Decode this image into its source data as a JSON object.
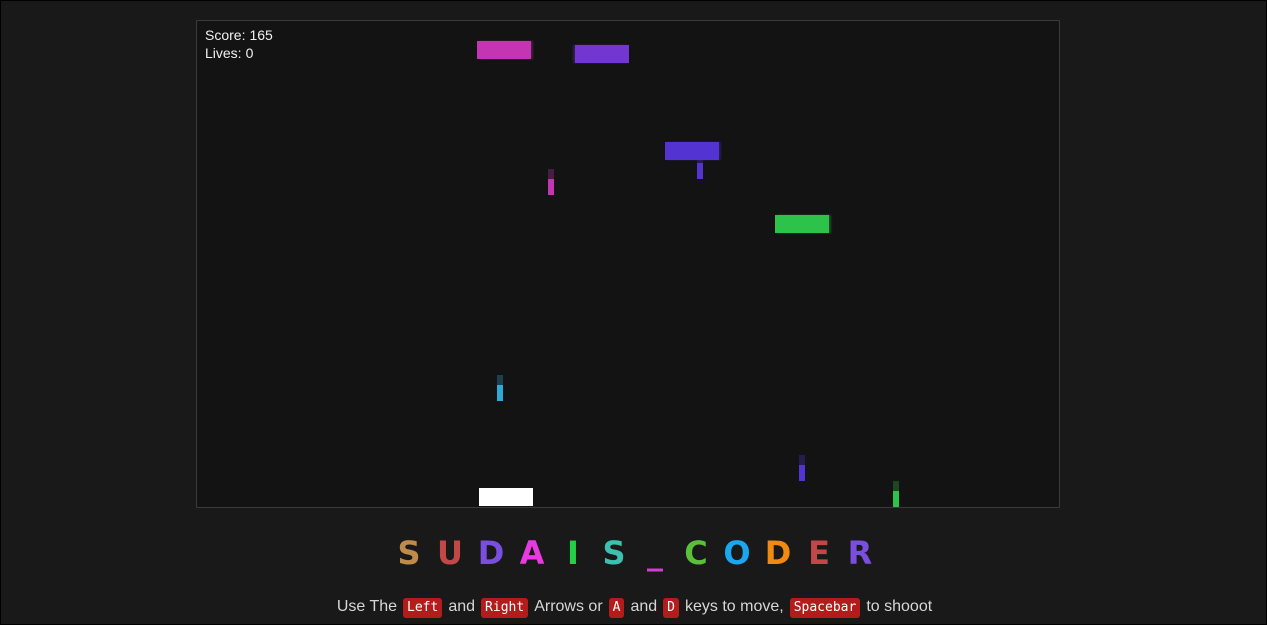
{
  "game": {
    "hud": {
      "score_label": "Score:",
      "score_value": "165",
      "lives_label": "Lives:",
      "lives_value": "0"
    },
    "enemies": [
      {
        "color": "#c435b4"
      },
      {
        "color": "#7436d0"
      },
      {
        "color": "#5334d2"
      },
      {
        "color": "#2dc34a"
      }
    ],
    "bullets": [
      {
        "color": "#c435b4"
      },
      {
        "color": "#5334d2"
      },
      {
        "color": "#2ea9d6"
      },
      {
        "color": "#5334d2"
      },
      {
        "color": "#2dc34a"
      }
    ],
    "player": {
      "color": "#ffffff"
    }
  },
  "brand": {
    "letters": [
      {
        "char": "S",
        "color": "#c08a4a"
      },
      {
        "char": "U",
        "color": "#c24848"
      },
      {
        "char": "D",
        "color": "#7a4ee0"
      },
      {
        "char": "A",
        "color": "#e83ae0"
      },
      {
        "char": "I",
        "color": "#26d046"
      },
      {
        "char": "S",
        "color": "#3fbfb0"
      },
      {
        "char": "_",
        "color": "#d040d0"
      },
      {
        "char": "C",
        "color": "#5abf3a"
      },
      {
        "char": "O",
        "color": "#1aa7f0"
      },
      {
        "char": "D",
        "color": "#f08a10"
      },
      {
        "char": "E",
        "color": "#c24848"
      },
      {
        "char": "R",
        "color": "#7a4ee0"
      }
    ]
  },
  "instructions": {
    "t1": "Use The",
    "k_left": "Left",
    "t2": "and",
    "k_right": "Right",
    "t3": "Arrows or",
    "k_a": "A",
    "t4": "and",
    "k_d": "D",
    "t5": "keys to move,",
    "k_space": "Spacebar",
    "t6": "to shooot"
  }
}
